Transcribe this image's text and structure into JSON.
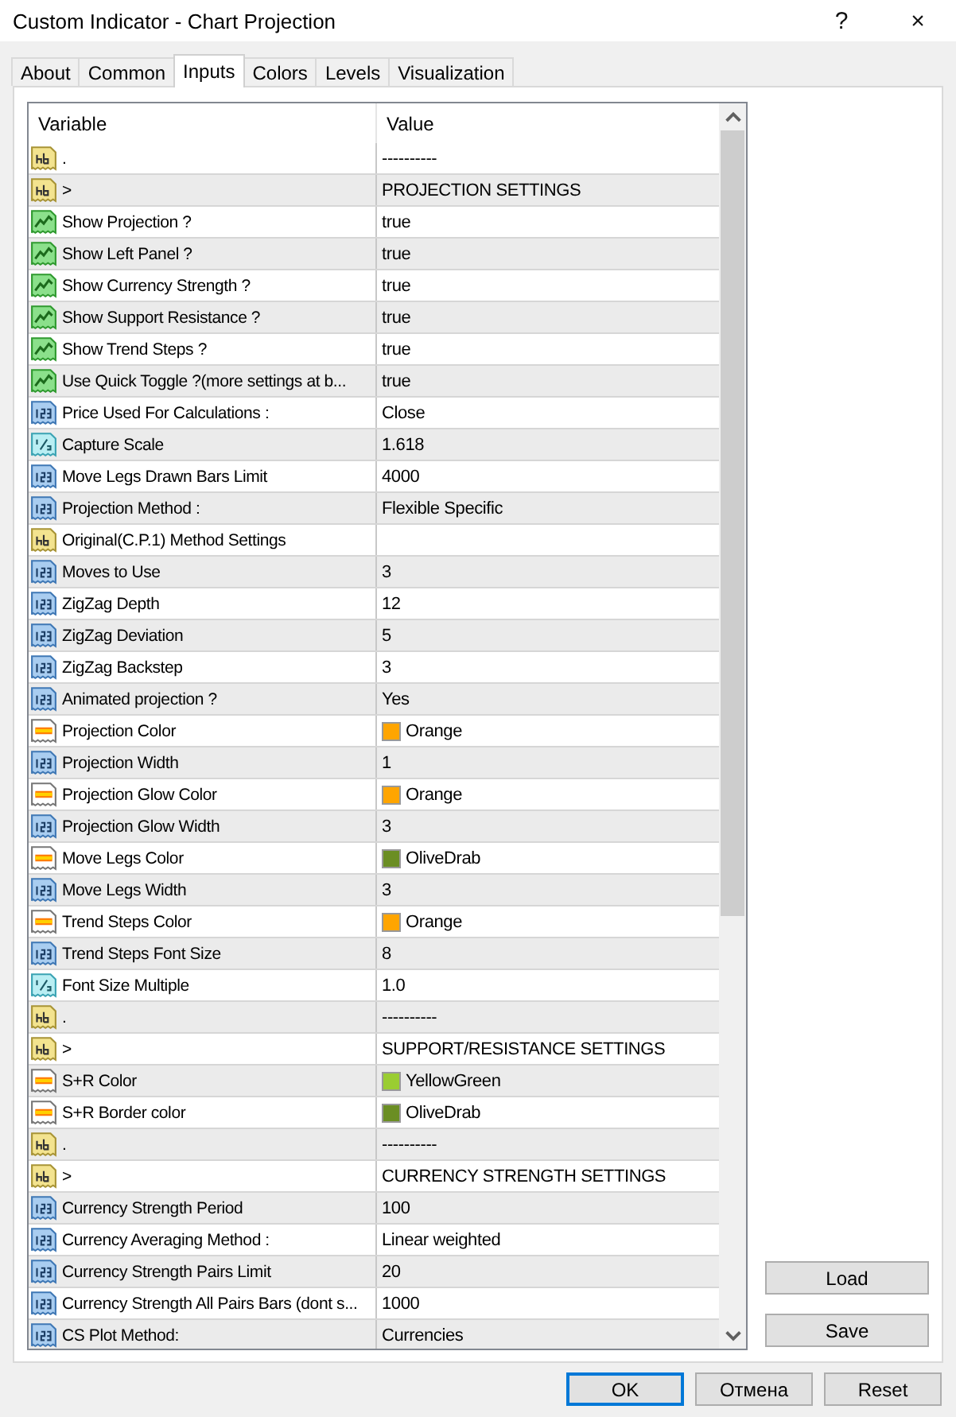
{
  "window": {
    "title": "Custom Indicator - Chart Projection",
    "controls": [
      "?",
      "×"
    ]
  },
  "tabs": [
    {
      "label": "About",
      "selected": false
    },
    {
      "label": "Common",
      "selected": false
    },
    {
      "label": "Inputs",
      "selected": true
    },
    {
      "label": "Colors",
      "selected": false
    },
    {
      "label": "Levels",
      "selected": false
    },
    {
      "label": "Visualization",
      "selected": false
    }
  ],
  "table": {
    "columns": [
      "Variable",
      "Value"
    ],
    "rows": [
      {
        "kind": "string",
        "variable": ".",
        "value": "----------"
      },
      {
        "kind": "string",
        "variable": ">",
        "value": "PROJECTION SETTINGS"
      },
      {
        "kind": "bool",
        "variable": "Show Projection ?",
        "value": "true"
      },
      {
        "kind": "bool",
        "variable": "Show Left Panel ?",
        "value": "true"
      },
      {
        "kind": "bool",
        "variable": "Show Currency Strength ?",
        "value": "true"
      },
      {
        "kind": "bool",
        "variable": "Show Support Resistance ?",
        "value": "true"
      },
      {
        "kind": "bool",
        "variable": "Show Trend Steps ?",
        "value": "true"
      },
      {
        "kind": "bool",
        "variable": "Use Quick Toggle ?(more settings at b...",
        "value": "true"
      },
      {
        "kind": "int",
        "variable": "Price Used For Calculations :",
        "value": "Close"
      },
      {
        "kind": "double",
        "variable": "Capture Scale",
        "value": "1.618"
      },
      {
        "kind": "int",
        "variable": "Move Legs Drawn Bars Limit",
        "value": "4000"
      },
      {
        "kind": "int",
        "variable": "Projection Method :",
        "value": "Flexible Specific"
      },
      {
        "kind": "string",
        "variable": "Original(C.P.1) Method Settings"
      },
      {
        "kind": "int",
        "variable": "Moves to Use",
        "value": "3"
      },
      {
        "kind": "int",
        "variable": "ZigZag Depth",
        "value": "12"
      },
      {
        "kind": "int",
        "variable": "ZigZag Deviation",
        "value": "5"
      },
      {
        "kind": "int",
        "variable": "ZigZag Backstep",
        "value": "3"
      },
      {
        "kind": "int",
        "variable": "Animated projection ?",
        "value": "Yes"
      },
      {
        "kind": "color",
        "variable": "Projection Color",
        "value": "Orange",
        "color": "#ffa500"
      },
      {
        "kind": "int",
        "variable": "Projection Width",
        "value": "1"
      },
      {
        "kind": "color",
        "variable": "Projection Glow Color",
        "value": "Orange",
        "color": "#ffa500"
      },
      {
        "kind": "int",
        "variable": "Projection Glow Width",
        "value": "3"
      },
      {
        "kind": "color",
        "variable": "Move Legs Color",
        "value": "OliveDrab",
        "color": "#6b8e23"
      },
      {
        "kind": "int",
        "variable": "Move Legs Width",
        "value": "3"
      },
      {
        "kind": "color",
        "variable": "Trend Steps Color",
        "value": "Orange",
        "color": "#ffa500"
      },
      {
        "kind": "int",
        "variable": "Trend Steps Font Size",
        "value": "8"
      },
      {
        "kind": "double",
        "variable": "Font Size Multiple",
        "value": "1.0"
      },
      {
        "kind": "string",
        "variable": ".",
        "value": "----------"
      },
      {
        "kind": "string",
        "variable": ">",
        "value": "SUPPORT/RESISTANCE SETTINGS"
      },
      {
        "kind": "color",
        "variable": "S+R Color",
        "value": "YellowGreen",
        "color": "#9acd32"
      },
      {
        "kind": "color",
        "variable": "S+R Border color",
        "value": "OliveDrab",
        "color": "#6b8e23"
      },
      {
        "kind": "string",
        "variable": ".",
        "value": "----------"
      },
      {
        "kind": "string",
        "variable": ">",
        "value": "CURRENCY STRENGTH SETTINGS"
      },
      {
        "kind": "int",
        "variable": "Currency Strength Period",
        "value": "100"
      },
      {
        "kind": "int",
        "variable": "Currency Averaging Method :",
        "value": "Linear weighted"
      },
      {
        "kind": "int",
        "variable": "Currency Strength Pairs Limit",
        "value": "20"
      },
      {
        "kind": "int",
        "variable": "Currency Strength All Pairs Bars (dont s...",
        "value": "1000"
      },
      {
        "kind": "int",
        "variable": "CS Plot Method:",
        "value": "Currencies"
      }
    ]
  },
  "side_buttons": [
    "Load",
    "Save"
  ],
  "buttons": [
    "OK",
    "Отмена",
    "Reset"
  ]
}
